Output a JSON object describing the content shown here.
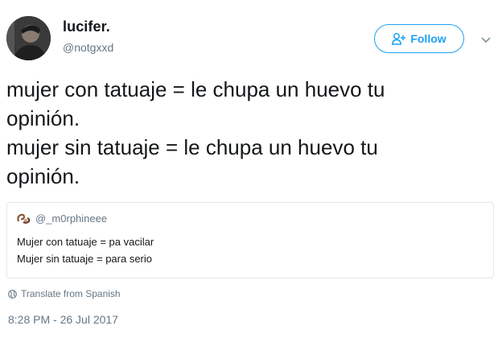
{
  "author": {
    "display_name": "lucifer.",
    "handle": "@notgxxd"
  },
  "follow_button": {
    "label": "Follow"
  },
  "tweet": {
    "lines": [
      "mujer con tatuaje = le chupa un huevo tu",
      "opinión.",
      "mujer sin tatuaje = le chupa un huevo tu",
      "opinión."
    ]
  },
  "quoted_tweet": {
    "handle": "@_m0rphineee",
    "lines": [
      "Mujer con tatuaje = pa vacilar",
      "Mujer sin tatuaje = para serio"
    ]
  },
  "translate": {
    "label": "Translate from Spanish",
    "icon": "globe-icon"
  },
  "timestamp": "8:28 PM - 26 Jul 2017",
  "colors": {
    "accent": "#1da1f2",
    "text": "#14171a",
    "secondary": "#657786",
    "border": "#e1e8ed"
  }
}
